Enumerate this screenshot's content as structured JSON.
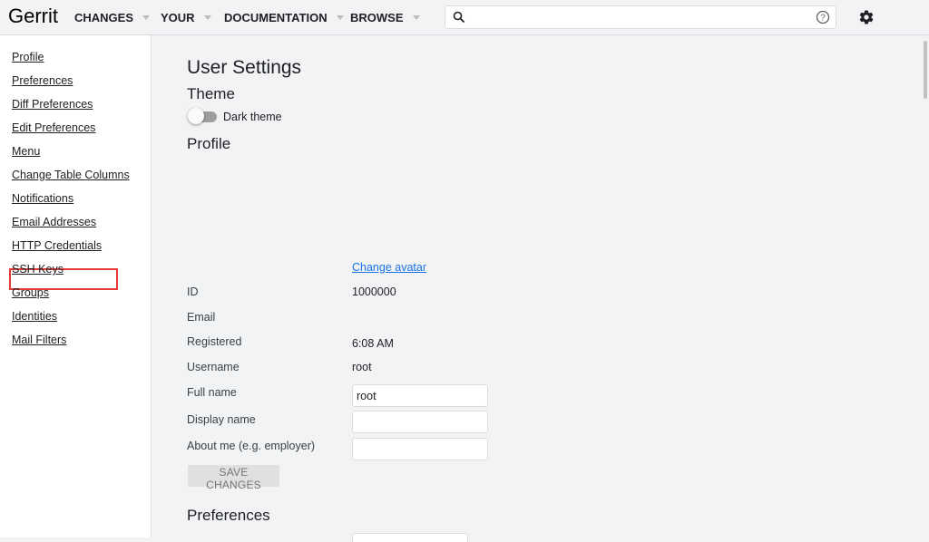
{
  "header": {
    "logo": "Gerrit",
    "nav": [
      "CHANGES",
      "YOUR",
      "DOCUMENTATION",
      "BROWSE"
    ],
    "search": {
      "placeholder": "",
      "value": ""
    }
  },
  "sidebar": {
    "items": [
      {
        "label": "Profile"
      },
      {
        "label": "Preferences"
      },
      {
        "label": "Diff Preferences"
      },
      {
        "label": "Edit Preferences"
      },
      {
        "label": "Menu"
      },
      {
        "label": "Change Table Columns"
      },
      {
        "label": "Notifications"
      },
      {
        "label": "Email Addresses"
      },
      {
        "label": "HTTP Credentials"
      },
      {
        "label": "SSH Keys"
      },
      {
        "label": "Groups"
      },
      {
        "label": "Identities"
      },
      {
        "label": "Mail Filters"
      }
    ],
    "highlighted_item": "HTTP Credentials",
    "highlight_color": "#e53935"
  },
  "main": {
    "title": "User Settings",
    "theme": {
      "heading": "Theme",
      "toggle_label": "Dark theme",
      "enabled": false
    },
    "profile": {
      "heading": "Profile",
      "change_avatar": "Change avatar",
      "id": {
        "label": "ID",
        "value": "1000000"
      },
      "email": {
        "label": "Email",
        "value": ""
      },
      "registered": {
        "label": "Registered",
        "value": "6:08 AM"
      },
      "username": {
        "label": "Username",
        "value": "root"
      },
      "full_name": {
        "label": "Full name",
        "value": "root"
      },
      "display_name": {
        "label": "Display name",
        "value": ""
      },
      "about_me": {
        "label": "About me (e.g. employer)",
        "value": ""
      },
      "save_label": "SAVE CHANGES"
    },
    "preferences": {
      "heading": "Preferences"
    }
  },
  "colors": {
    "link": "#1a73e8",
    "background": "#f1f3f4",
    "sidebar_bg": "#ffffff"
  }
}
